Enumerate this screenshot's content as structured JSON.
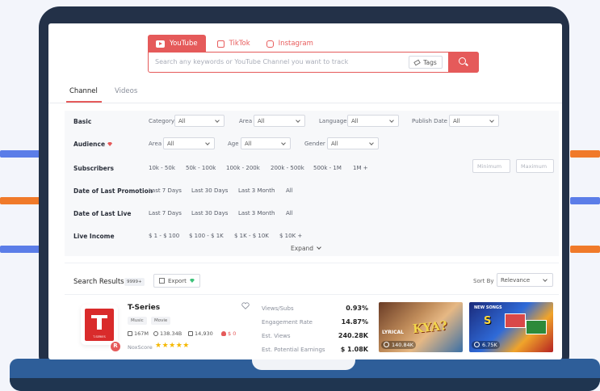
{
  "platforms": [
    {
      "label": "YouTube",
      "icon": "youtube-icon",
      "active": true
    },
    {
      "label": "TikTok",
      "icon": "tiktok-icon",
      "active": false
    },
    {
      "label": "Instagram",
      "icon": "instagram-icon",
      "active": false
    }
  ],
  "search": {
    "placeholder": "Search any keywords or YouTube Channel you want to track",
    "tags_label": "Tags"
  },
  "main_tabs": [
    {
      "label": "Channel",
      "active": true
    },
    {
      "label": "Videos",
      "active": false
    }
  ],
  "filters": {
    "basic": {
      "label": "Basic",
      "category_label": "Category",
      "category_value": "All",
      "area_label": "Area",
      "area_value": "All",
      "language_label": "Language",
      "language_value": "All",
      "publish_label": "Publish Date",
      "publish_value": "All"
    },
    "audience": {
      "label": "Audience",
      "area_label": "Area",
      "area_value": "All",
      "age_label": "Age",
      "age_value": "All",
      "gender_label": "Gender",
      "gender_value": "All"
    },
    "subscribers": {
      "label": "Subscribers",
      "options": [
        "10k - 50k",
        "50k - 100k",
        "100k - 200k",
        "200k - 500k",
        "500k - 1M",
        "1M +"
      ],
      "min_placeholder": "Minimum",
      "max_placeholder": "Maximum"
    },
    "last_promotion": {
      "label": "Date of Last Promotion",
      "options": [
        "Last 7 Days",
        "Last 30 Days",
        "Last 3 Month",
        "All"
      ]
    },
    "last_live": {
      "label": "Date of Last Live",
      "options": [
        "Last 7 Days",
        "Last 30 Days",
        "Last 3 Month",
        "All"
      ]
    },
    "live_income": {
      "label": "Live Income",
      "options": [
        "$ 1 - $ 100",
        "$ 100 - $ 1K",
        "$ 1K - $ 10K",
        "$ 10K +"
      ]
    },
    "expand_label": "Expand"
  },
  "results": {
    "title": "Search Results",
    "count": "9999+",
    "export_label": "Export",
    "sort_label": "Sort By",
    "sort_value": "Relevance",
    "channel": {
      "name": "T-Series",
      "avatar_text": "T-SERIES",
      "badge": "R",
      "tags": [
        "Music",
        "Movie"
      ],
      "subscribers": "167M",
      "views": "138.34B",
      "videos": "14,930",
      "income": "$ 0",
      "noxscore_label": "NoxScore",
      "noxscore_stars": 5,
      "metrics": [
        {
          "label": "Views/Subs",
          "value": "0.93%"
        },
        {
          "label": "Engagement Rate",
          "value": "14.87%"
        },
        {
          "label": "Est. Views",
          "value": "240.28K"
        },
        {
          "label": "Est. Potential Earnings",
          "value": "$ 1.08K"
        }
      ],
      "videos_list": [
        {
          "views": "140.84K",
          "title_art": "KYA?",
          "overlay": "LYRICAL"
        },
        {
          "views": "6.75K",
          "title_art": "S",
          "overlay": "NEW SONGS"
        }
      ]
    }
  },
  "colors": {
    "accent": "#e55a5a",
    "laptop_frame": "#233148",
    "laptop_base": "#2e5e99",
    "deco_blue": "#5b7de8",
    "deco_orange": "#f07a2a",
    "star": "#f5b800"
  }
}
